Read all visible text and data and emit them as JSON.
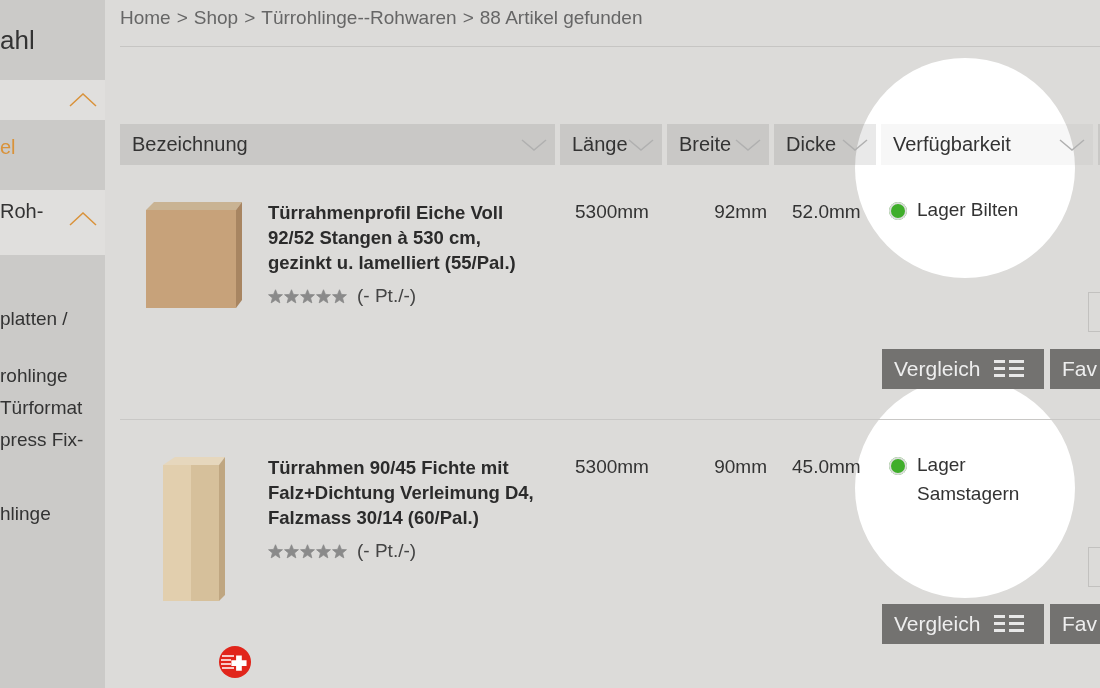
{
  "sidebar": {
    "title": "ahl",
    "items": [
      {
        "kind": "toggle",
        "expanded": true
      },
      {
        "label": "el",
        "kind": "active"
      },
      {
        "label": "Roh-",
        "kind": "group",
        "expanded": true
      },
      {
        "label": "platten /",
        "kind": "link"
      },
      {
        "label": "rohlinge",
        "kind": "link"
      },
      {
        "label": "Türformat",
        "kind": "link"
      },
      {
        "label": "press Fix-",
        "kind": "link"
      },
      {
        "label": "hlinge",
        "kind": "link"
      }
    ]
  },
  "breadcrumb": [
    "Home",
    "Shop",
    "Türrohlinge--Rohwaren",
    "88 Artikel gefunden"
  ],
  "breadcrumb_separators": [
    ">",
    ">",
    ">"
  ],
  "table": {
    "columns": [
      "Bezeichnung",
      "Länge",
      "Breite",
      "Dicke",
      "Verfügbarkeit"
    ],
    "rows": [
      {
        "name": "Türrahmenprofil Eiche Voll 92/52 Stangen à 530 cm, gezinkt u. lamelliert (55/Pal.)",
        "stars": 0,
        "rating": "(- Pt./-)",
        "length": "5300mm",
        "width": "92mm",
        "thickness": "52.0mm",
        "availability": "Lager Bilten",
        "color": "#3fae2a",
        "swiss": false,
        "kind": "block",
        "buttons": [
          "Vergleich",
          "Fav"
        ]
      },
      {
        "name": "Türrahmen 90/45 Fichte mit Falz+Dichtung Verleimung D4, Falzmass 30/14 (60/Pal.)",
        "stars": 0,
        "rating": "(- Pt./-)",
        "length": "5300mm",
        "width": "90mm",
        "thickness": "45.0mm",
        "availability": "Lager Samstagern",
        "color": "#3fae2a",
        "swiss": true,
        "kind": "frame",
        "buttons": [
          "Vergleich",
          "Fav"
        ]
      }
    ]
  }
}
